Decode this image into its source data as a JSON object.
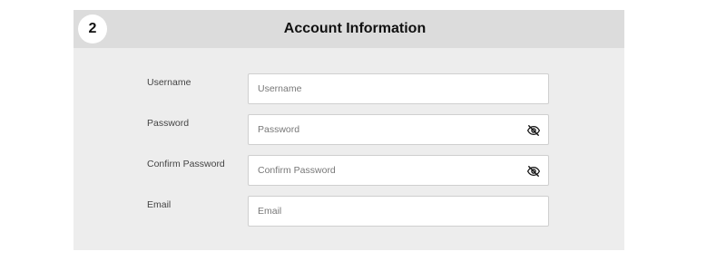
{
  "section": {
    "step_number": "2",
    "title": "Account Information"
  },
  "fields": {
    "username": {
      "label": "Username",
      "placeholder": "Username",
      "value": ""
    },
    "password": {
      "label": "Password",
      "placeholder": "Password",
      "value": "",
      "toggle_icon": "eye-slash-icon"
    },
    "confirm_password": {
      "label": "Confirm Password",
      "placeholder": "Confirm Password",
      "value": "",
      "toggle_icon": "eye-slash-icon"
    },
    "email": {
      "label": "Email",
      "placeholder": "Email",
      "value": ""
    }
  },
  "colors": {
    "header_bg": "#dcdcdc",
    "card_bg": "#ededed",
    "input_border": "#cfcfcf"
  }
}
